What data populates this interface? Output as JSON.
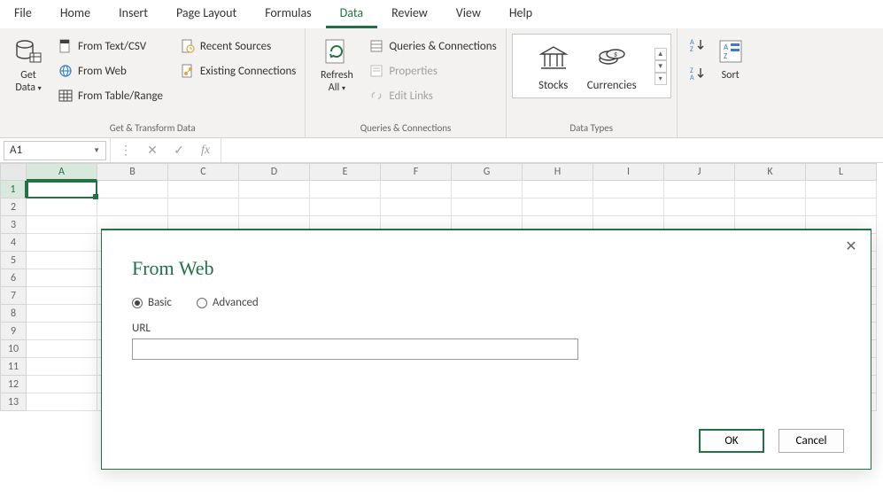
{
  "tabs": [
    "File",
    "Home",
    "Insert",
    "Page Layout",
    "Formulas",
    "Data",
    "Review",
    "View",
    "Help"
  ],
  "active_tab": "Data",
  "ribbon": {
    "get_transform": {
      "get_data": "Get\nData",
      "from_text_csv": "From Text/CSV",
      "from_web": "From Web",
      "from_table_range": "From Table/Range",
      "recent_sources": "Recent Sources",
      "existing_connections": "Existing Connections",
      "label": "Get & Transform Data"
    },
    "queries": {
      "refresh_all": "Refresh\nAll",
      "queries_connections": "Queries & Connections",
      "properties": "Properties",
      "edit_links": "Edit Links",
      "label": "Queries & Connections"
    },
    "data_types": {
      "stocks": "Stocks",
      "currencies": "Currencies",
      "label": "Data Types"
    },
    "sort": {
      "sort": "Sort"
    }
  },
  "formula_bar": {
    "name_box": "A1",
    "formula": ""
  },
  "columns": [
    "A",
    "B",
    "C",
    "D",
    "E",
    "F",
    "G",
    "H",
    "I",
    "J",
    "K",
    "L"
  ],
  "rows": [
    "1",
    "2",
    "3",
    "4",
    "5",
    "6",
    "7",
    "8",
    "9",
    "10",
    "11",
    "12",
    "13"
  ],
  "active_cell": "A1",
  "dialog": {
    "title": "From Web",
    "radio_basic": "Basic",
    "radio_advanced": "Advanced",
    "url_label": "URL",
    "url_value": "",
    "ok": "OK",
    "cancel": "Cancel"
  }
}
